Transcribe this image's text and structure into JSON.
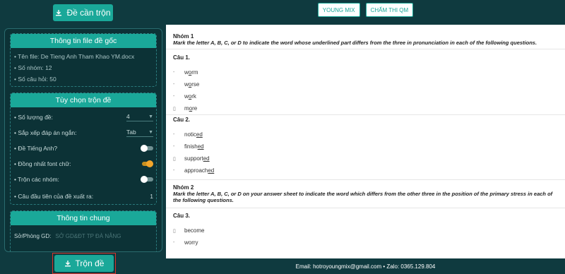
{
  "left": {
    "top_button": "Đề cần trộn",
    "file_info": {
      "header": "Thông tin file đề gốc",
      "lines": [
        "• Tên file: De Tieng Anh Tham Khao YM.docx",
        "• Số nhóm: 12",
        "• Số câu hỏi: 50"
      ]
    },
    "options": {
      "header": "Tùy chọn trộn đề",
      "num_tests_label": "• Số lượng đề:",
      "num_tests_value": "4",
      "sort_label": "• Sắp xếp đáp án ngắn:",
      "sort_value": "Tab",
      "english_label": "• Đề Tiếng Anh?",
      "english_on": false,
      "font_label": "• Đồng nhất font chữ:",
      "font_on": true,
      "shuffle_groups_label": "• Trộn các nhóm:",
      "shuffle_groups_on": false,
      "first_q_label": "• Câu đầu tiên của đề xuất ra:",
      "first_q_value": "1"
    },
    "general": {
      "header": "Thông tin chung",
      "dept_label": "Sở/Phòng GD:",
      "dept_placeholder": "SỞ GD&ĐT TP ĐÀ NẴNG"
    },
    "bottom_button": "Trộn đề"
  },
  "right": {
    "tabs": [
      "YOUNG MIX",
      "CHẤM THI QM"
    ],
    "doc": {
      "group1_title": "Nhóm 1",
      "group1_instr": "Mark the letter A, B, C, or D to indicate the word whose underlined part differs from the three in pronunciation in each of the following questions.",
      "q1_title": "Câu 1.",
      "q1_answers": [
        {
          "mark": "-",
          "pre": "w",
          "u": "o",
          "post": "rm"
        },
        {
          "mark": "-",
          "pre": "w",
          "u": "o",
          "post": "rse"
        },
        {
          "mark": "-",
          "pre": "w",
          "u": "o",
          "post": "rk"
        },
        {
          "mark": "▯",
          "pre": "m",
          "u": "o",
          "post": "re"
        }
      ],
      "q2_title": "Câu 2.",
      "q2_answers": [
        {
          "mark": "-",
          "pre": "notic",
          "u": "ed",
          "post": ""
        },
        {
          "mark": "-",
          "pre": "finish",
          "u": "ed",
          "post": ""
        },
        {
          "mark": "▯",
          "pre": "support",
          "u": "ed",
          "post": ""
        },
        {
          "mark": "-",
          "pre": "approach",
          "u": "ed",
          "post": ""
        }
      ],
      "group2_title": "Nhóm 2",
      "group2_instr": "Mark the letter A, B, C, or D on your answer sheet to indicate the word which differs from the other three in the position of the primary stress in each of the following questions.",
      "q3_title": "Câu 3.",
      "q3_answers": [
        {
          "mark": "▯",
          "text": "become"
        },
        {
          "mark": "-",
          "text": "worry"
        }
      ]
    },
    "footer": "Email: hotroyoungmix@gmail.com • Zalo: 0365.129.804"
  }
}
